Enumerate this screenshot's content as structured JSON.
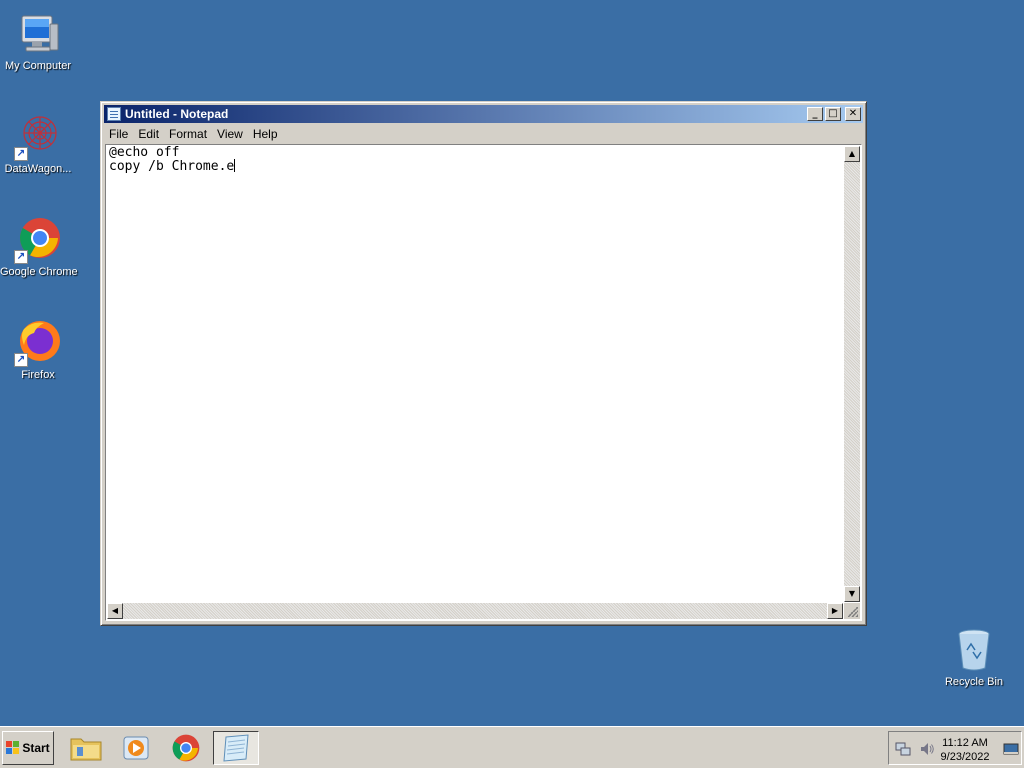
{
  "desktop": {
    "icons": [
      {
        "label": "My Computer"
      },
      {
        "label": "DataWagon..."
      },
      {
        "label": "Google Chrome"
      },
      {
        "label": "Firefox"
      },
      {
        "label": "Recycle Bin"
      }
    ]
  },
  "notepad": {
    "title": "Untitled - Notepad",
    "menu": [
      "File",
      "Edit",
      "Format",
      "View",
      "Help"
    ],
    "lines": [
      "@echo off",
      "copy /b Chrome.e"
    ]
  },
  "taskbar": {
    "start_label": "Start",
    "clock_time": "11:12 AM",
    "clock_date": "9/23/2022"
  },
  "colors": {
    "desktop_bg": "#3a6ea5",
    "titlebar_start": "#0a246a",
    "titlebar_end": "#a6caf0",
    "chrome": "#d4d0c8"
  }
}
